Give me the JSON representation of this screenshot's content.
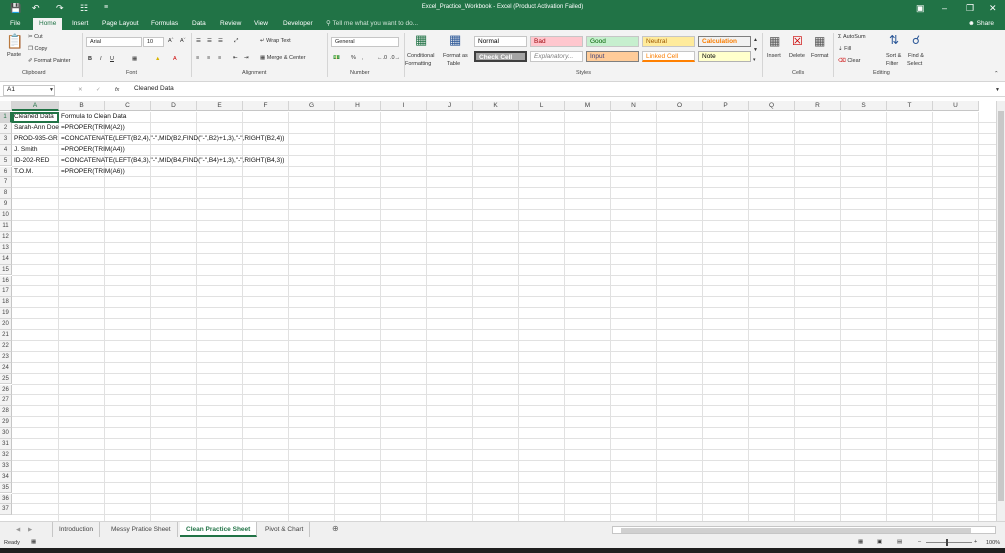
{
  "window": {
    "title": "Excel_Practice_Workbook - Excel (Product Activation Failed)"
  },
  "tabs": [
    "File",
    "Home",
    "Insert",
    "Page Layout",
    "Formulas",
    "Data",
    "Review",
    "View",
    "Developer"
  ],
  "tell_me": "Tell me what you want to do...",
  "share": "Share",
  "ribbon": {
    "clipboard": {
      "paste": "Paste",
      "cut": "Cut",
      "copy": "Copy",
      "format_painter": "Format Painter",
      "label": "Clipboard"
    },
    "font": {
      "name": "Arial",
      "size": "10",
      "label": "Font"
    },
    "alignment": {
      "wrap": "Wrap Text",
      "merge": "Merge & Center",
      "label": "Alignment"
    },
    "number": {
      "format": "General",
      "percent": "%",
      "label": "Number"
    },
    "styles": {
      "conditional": "Conditional",
      "conditional2": "Formatting",
      "format_table": "Format as",
      "format_table2": "Table",
      "normal": "Normal",
      "bad": "Bad",
      "good": "Good",
      "neutral": "Neutral",
      "calculation": "Calculation",
      "check_cell": "Check Cell",
      "explanatory": "Explanatory...",
      "input": "Input",
      "linked": "Linked Cell",
      "note": "Note",
      "label": "Styles"
    },
    "cells": {
      "insert": "Insert",
      "delete": "Delete",
      "format": "Format",
      "label": "Cells"
    },
    "editing": {
      "autosum": "AutoSum",
      "fill": "Fill",
      "clear": "Clear",
      "sort": "Sort &",
      "sort2": "Filter",
      "find": "Find &",
      "find2": "Select",
      "label": "Editing"
    }
  },
  "formula_bar": {
    "name_box": "A1",
    "fx": "fx",
    "content": "Cleaned Data"
  },
  "columns": [
    "A",
    "B",
    "C",
    "D",
    "E",
    "F",
    "G",
    "H",
    "I",
    "J",
    "K",
    "L",
    "M",
    "N",
    "O",
    "P",
    "Q",
    "R",
    "S",
    "T",
    "U"
  ],
  "rows": [
    "1",
    "2",
    "3",
    "4",
    "5",
    "6",
    "7",
    "8",
    "9",
    "10",
    "11",
    "12",
    "13",
    "14",
    "15",
    "16",
    "17",
    "18",
    "19",
    "20",
    "21",
    "22",
    "23",
    "24",
    "25",
    "26",
    "27",
    "28",
    "29",
    "30",
    "31",
    "32",
    "33",
    "34",
    "35",
    "36",
    "37"
  ],
  "cells": {
    "A": [
      "Cleaned Data",
      "Sarah-Ann Doe",
      "PROD-935-GR",
      "J. Smith",
      "ID-202-RED",
      "T.O.M."
    ],
    "B": [
      "Formula to Clean Data",
      "=PROPER(TRIM(A2))",
      "=CONCATENATE(LEFT(B2,4),\"-\",MID(B2,FIND(\"-\",B2)+1,3),\"-\",RIGHT(B2,4))",
      "=PROPER(TRIM(A4))",
      "=CONCATENATE(LEFT(B4,3),\"-\",MID(B4,FIND(\"-\",B4)+1,3),\"-\",RIGHT(B4,3))",
      "=PROPER(TRIM(A6))"
    ]
  },
  "sheets": [
    "Introduction",
    "Messy Pratice Sheet",
    "Clean Practice Sheet",
    "Pivot & Chart"
  ],
  "active_sheet": "Clean Practice Sheet",
  "status": {
    "ready": "Ready",
    "zoom": "100%"
  },
  "colors": {
    "brand": "#217346"
  }
}
